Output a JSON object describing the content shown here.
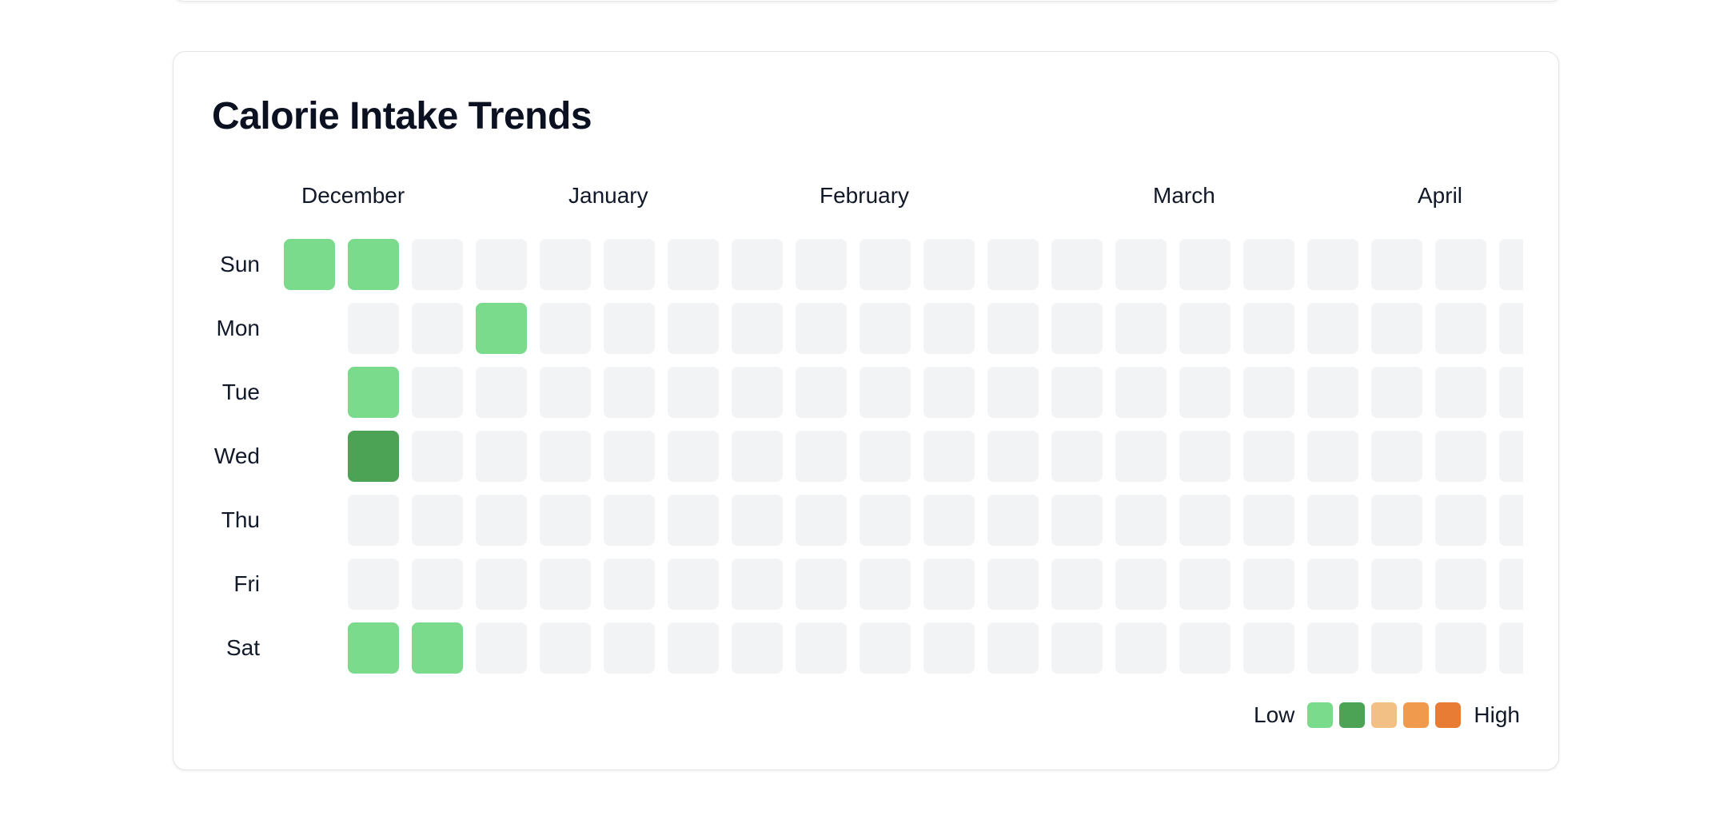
{
  "chart_data": {
    "type": "heatmap",
    "title": "Calorie Intake Trends",
    "month_labels": [
      {
        "label": "December",
        "week": 0
      },
      {
        "label": "January",
        "week": 4
      },
      {
        "label": "February",
        "week": 8
      },
      {
        "label": "March",
        "week": 13
      },
      {
        "label": "April",
        "week": 17
      }
    ],
    "day_labels": [
      "Sun",
      "Mon",
      "Tue",
      "Wed",
      "Thu",
      "Fri",
      "Sat"
    ],
    "weeks_visible": 20,
    "first_week_start_day": 0,
    "first_week_days_shown": 1,
    "legend": {
      "low_label": "Low",
      "high_label": "High",
      "colors": [
        "#7adb8c",
        "#4ca355",
        "#f2bf85",
        "#ef9a4d",
        "#e87c35"
      ]
    },
    "empty_color": "#f2f3f5",
    "active_cells": [
      {
        "week": 0,
        "day": "Sun",
        "level": 1
      },
      {
        "week": 1,
        "day": "Sun",
        "level": 1
      },
      {
        "week": 1,
        "day": "Tue",
        "level": 1
      },
      {
        "week": 1,
        "day": "Wed",
        "level": 2
      },
      {
        "week": 1,
        "day": "Sat",
        "level": 1
      },
      {
        "week": 2,
        "day": "Sat",
        "level": 1
      },
      {
        "week": 3,
        "day": "Mon",
        "level": 1
      }
    ]
  }
}
